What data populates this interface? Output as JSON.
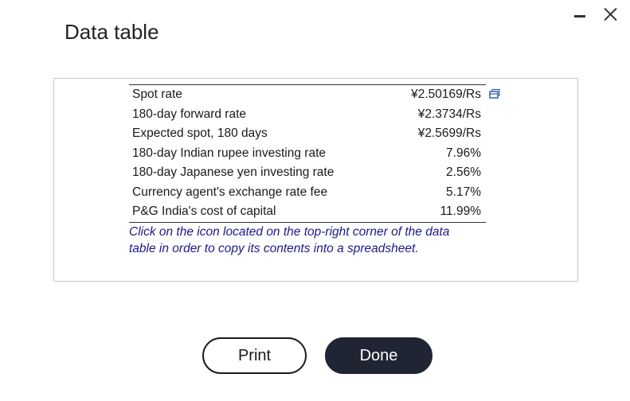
{
  "dialog": {
    "title": "Data table"
  },
  "window_controls": {
    "minimize_icon": "minimize-icon",
    "close_icon": "close-icon"
  },
  "table": {
    "rows": [
      {
        "label": "Spot rate",
        "value": "¥2.50169/Rs"
      },
      {
        "label": "180-day forward rate",
        "value": "¥2.3734/Rs"
      },
      {
        "label": "Expected spot, 180 days",
        "value": "¥2.5699/Rs"
      },
      {
        "label": "180-day Indian rupee investing rate",
        "value": "7.96%"
      },
      {
        "label": "180-day Japanese yen investing rate",
        "value": "2.56%"
      },
      {
        "label": "Currency agent's exchange rate fee",
        "value": "5.17%"
      },
      {
        "label": "P&G India's cost of capital",
        "value": "11.99%"
      }
    ],
    "copy_icon": "copy-to-spreadsheet-icon",
    "note": "Click on the icon located on the top-right corner of the data table in order to copy its contents into a spreadsheet."
  },
  "buttons": {
    "print_label": "Print",
    "done_label": "Done"
  },
  "colors": {
    "note_text": "#1a1a8c",
    "done_bg": "#1f2533",
    "copy_icon": "#3a5fa8"
  }
}
